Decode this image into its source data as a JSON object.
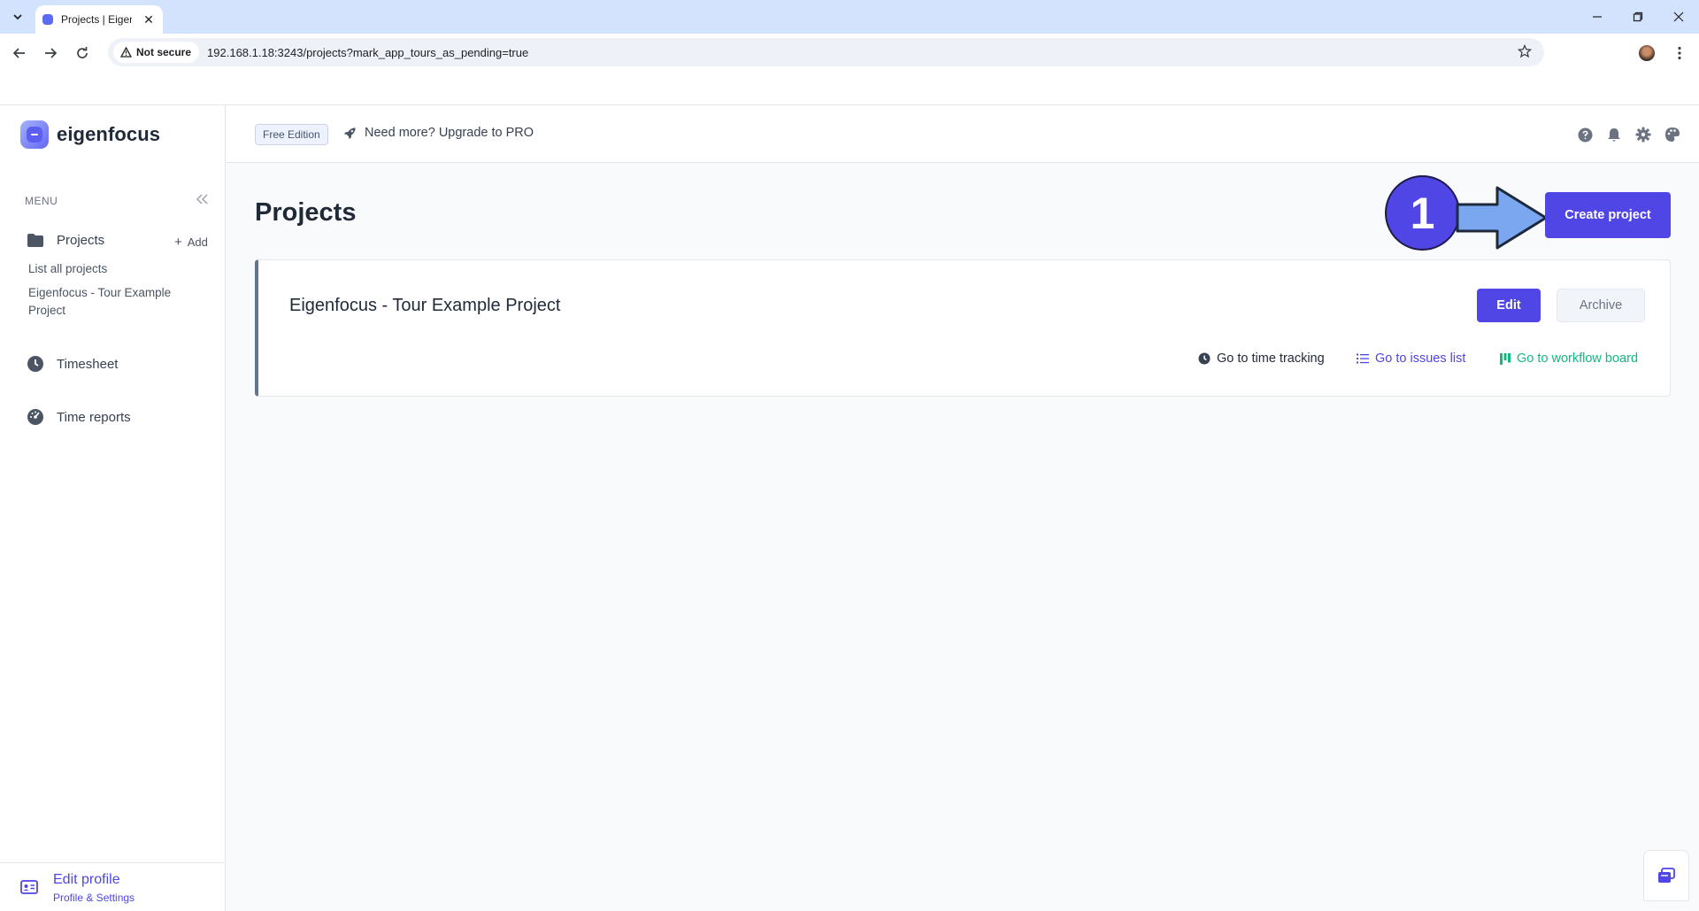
{
  "browser": {
    "tab_title": "Projects | Eigenfocus",
    "security_label": "Not secure",
    "url": "192.168.1.18:3243/projects?mark_app_tours_as_pending=true"
  },
  "app": {
    "brand_name": "eigenfocus",
    "accent_color": "#4f46e5"
  },
  "sidebar": {
    "menu_label": "MENU",
    "projects_label": "Projects",
    "add_label": "Add",
    "sub_links": [
      "List all projects",
      "Eigenfocus - Tour Example Project"
    ],
    "timesheet_label": "Timesheet",
    "time_reports_label": "Time reports",
    "footer": {
      "title": "Edit profile",
      "subtitle": "Profile & Settings"
    }
  },
  "header": {
    "edition_badge": "Free Edition",
    "upgrade_text": "Need more? Upgrade to PRO"
  },
  "main": {
    "page_title": "Projects",
    "tour_step": "1",
    "create_button": "Create project",
    "project": {
      "name": "Eigenfocus - Tour Example Project",
      "edit_label": "Edit",
      "archive_label": "Archive",
      "time_tracking_link": "Go to time tracking",
      "issues_link": "Go to issues list",
      "workflow_link": "Go to workflow board"
    }
  }
}
